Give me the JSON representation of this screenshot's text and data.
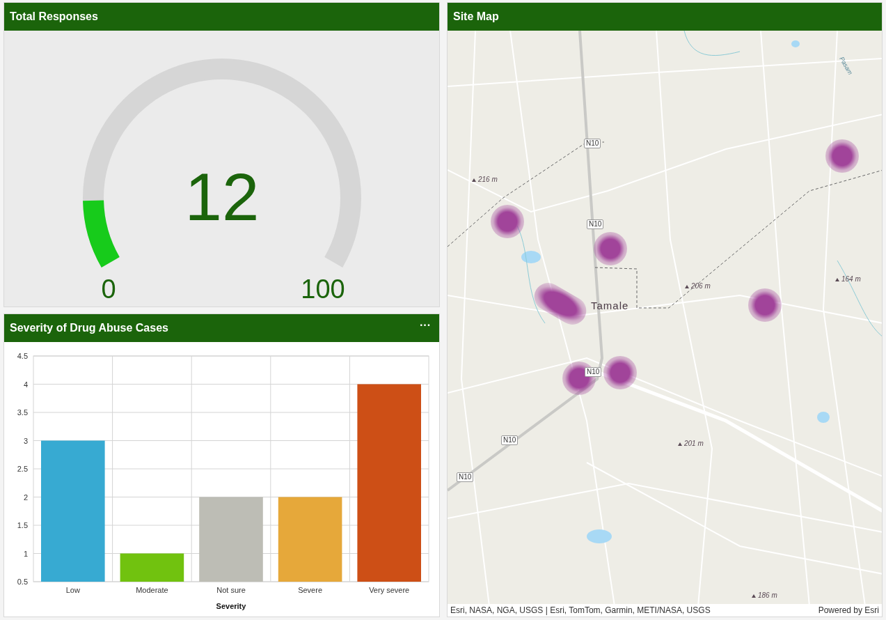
{
  "gauge_panel": {
    "title": "Total Responses",
    "value": "12",
    "min": "0",
    "max": "100",
    "level": 0.12
  },
  "chart_panel": {
    "title": "Severity of Drug Abuse Cases",
    "menu": "···",
    "chart_data": {
      "type": "bar",
      "xlabel": "Severity",
      "series": [
        {
          "name": "Low",
          "color": "#37aad2",
          "values": [
            3,
            null,
            null,
            null,
            null
          ]
        },
        {
          "name": "Moderate",
          "color": "#71c20f",
          "values": [
            null,
            1,
            null,
            null,
            null
          ]
        },
        {
          "name": "Not sure",
          "color": "#bdbdb5",
          "values": [
            null,
            null,
            2,
            null,
            null
          ]
        },
        {
          "name": "Severe",
          "color": "#e6a83a",
          "values": [
            null,
            null,
            null,
            2,
            null
          ]
        },
        {
          "name": "Very severe",
          "color": "#cd4f16",
          "values": [
            null,
            null,
            null,
            null,
            4
          ]
        }
      ],
      "grid": true,
      "ylim": [
        0.5,
        4.5
      ],
      "yticks": [
        {
          "value": 0.5,
          "label": "0.5"
        },
        {
          "value": 1,
          "label": "1"
        },
        {
          "value": 1.5,
          "label": "1.5"
        },
        {
          "value": 2,
          "label": "2"
        },
        {
          "value": 2.5,
          "label": "2.5"
        },
        {
          "value": 3,
          "label": "3"
        },
        {
          "value": 3.5,
          "label": "3.5"
        },
        {
          "value": 4,
          "label": "4"
        },
        {
          "value": 4.5,
          "label": "4.5"
        }
      ]
    }
  },
  "map_panel": {
    "title": "Site Map",
    "labels": [
      {
        "kind": "road",
        "text": "N10"
      },
      {
        "kind": "road",
        "text": "N10"
      },
      {
        "kind": "road",
        "text": "N10"
      },
      {
        "kind": "road",
        "text": "N10"
      },
      {
        "kind": "road",
        "text": "N10"
      },
      {
        "kind": "elevation",
        "text": "216 m"
      },
      {
        "kind": "elevation",
        "text": "206 m"
      },
      {
        "kind": "elevation",
        "text": "164 m"
      },
      {
        "kind": "elevation",
        "text": "201 m"
      },
      {
        "kind": "elevation",
        "text": "186 m"
      },
      {
        "kind": "place",
        "text": "Tamale"
      },
      {
        "kind": "stream",
        "text": "Pasam"
      }
    ],
    "attribution": "Esri, NASA, NGA, USGS | Esri, TomTom, Garmin, METI/NASA, USGS",
    "powered_by": "Powered by Esri"
  }
}
